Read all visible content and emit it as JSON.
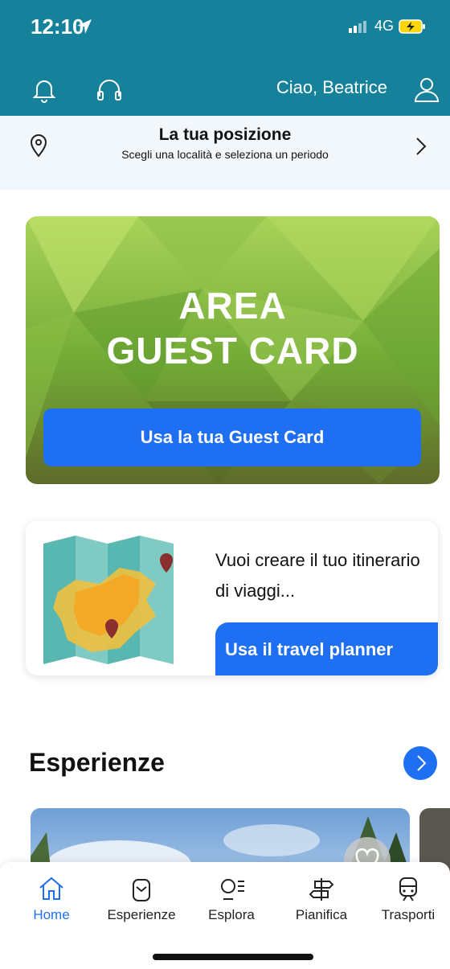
{
  "status_bar": {
    "time": "12:10",
    "network": "4G"
  },
  "header": {
    "greeting": "Ciao, Beatrice"
  },
  "location": {
    "title": "La tua posizione",
    "subtitle": "Scegli una località e seleziona un periodo"
  },
  "guest_card": {
    "title_line1": "AREA",
    "title_line2": "GUEST CARD",
    "button": "Usa la tua Guest Card"
  },
  "planner": {
    "text": "Vuoi creare il tuo itinerario di viaggi...",
    "button": "Usa il travel planner"
  },
  "experiences": {
    "title": "Esperienze"
  },
  "tabs": [
    {
      "label": "Home",
      "icon": "home-icon",
      "active": true
    },
    {
      "label": "Esperienze",
      "icon": "backpack-icon",
      "active": false
    },
    {
      "label": "Esplora",
      "icon": "explore-icon",
      "active": false
    },
    {
      "label": "Pianifica",
      "icon": "signpost-icon",
      "active": false
    },
    {
      "label": "Trasporti",
      "icon": "train-icon",
      "active": false
    }
  ],
  "colors": {
    "header": "#16819a",
    "accent": "#1f6ff2"
  }
}
